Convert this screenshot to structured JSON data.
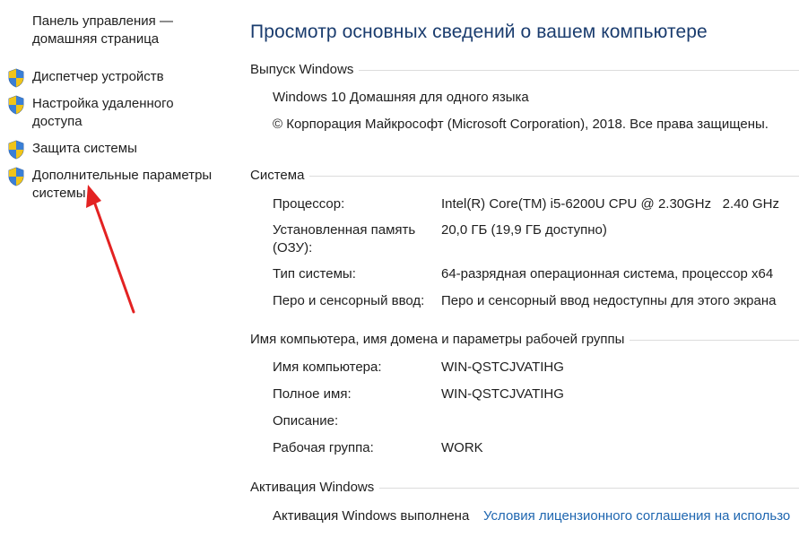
{
  "sidebar": {
    "home_link": "Панель управления — домашняя страница",
    "items": [
      {
        "label": "Диспетчер устройств",
        "icon": "shield-icon"
      },
      {
        "label": "Настройка удаленного доступа",
        "icon": "shield-icon"
      },
      {
        "label": "Защита системы",
        "icon": "shield-icon"
      },
      {
        "label": "Дополнительные параметры системы",
        "icon": "shield-icon"
      }
    ]
  },
  "main": {
    "title": "Просмотр основных сведений о вашем компьютере",
    "edition": {
      "heading": "Выпуск Windows",
      "name": "Windows 10 Домашняя для одного языка",
      "copyright": "© Корпорация Майкрософт (Microsoft Corporation), 2018. Все права защищены."
    },
    "system": {
      "heading": "Система",
      "rows": [
        {
          "label": "Процессор:",
          "value": "Intel(R) Core(TM) i5-6200U CPU @ 2.30GHz   2.40 GHz"
        },
        {
          "label": "Установленная память (ОЗУ):",
          "value": "20,0 ГБ (19,9 ГБ доступно)"
        },
        {
          "label": "Тип системы:",
          "value": "64-разрядная операционная система, процессор x64"
        },
        {
          "label": "Перо и сенсорный ввод:",
          "value": "Перо и сенсорный ввод недоступны для этого экрана"
        }
      ]
    },
    "computer": {
      "heading": "Имя компьютера, имя домена и параметры рабочей группы",
      "rows": [
        {
          "label": "Имя компьютера:",
          "value": "WIN-QSTCJVATIHG"
        },
        {
          "label": "Полное имя:",
          "value": "WIN-QSTCJVATIHG"
        },
        {
          "label": "Описание:",
          "value": ""
        },
        {
          "label": "Рабочая группа:",
          "value": "WORK"
        }
      ]
    },
    "activation": {
      "heading": "Активация Windows",
      "status": "Активация Windows выполнена",
      "license_link": "Условия лицензионного соглашения на использо"
    }
  },
  "colors": {
    "title": "#1a3c6e",
    "link": "#1e66b0",
    "arrow": "#e32222",
    "section_line": "#dcdcdc"
  }
}
